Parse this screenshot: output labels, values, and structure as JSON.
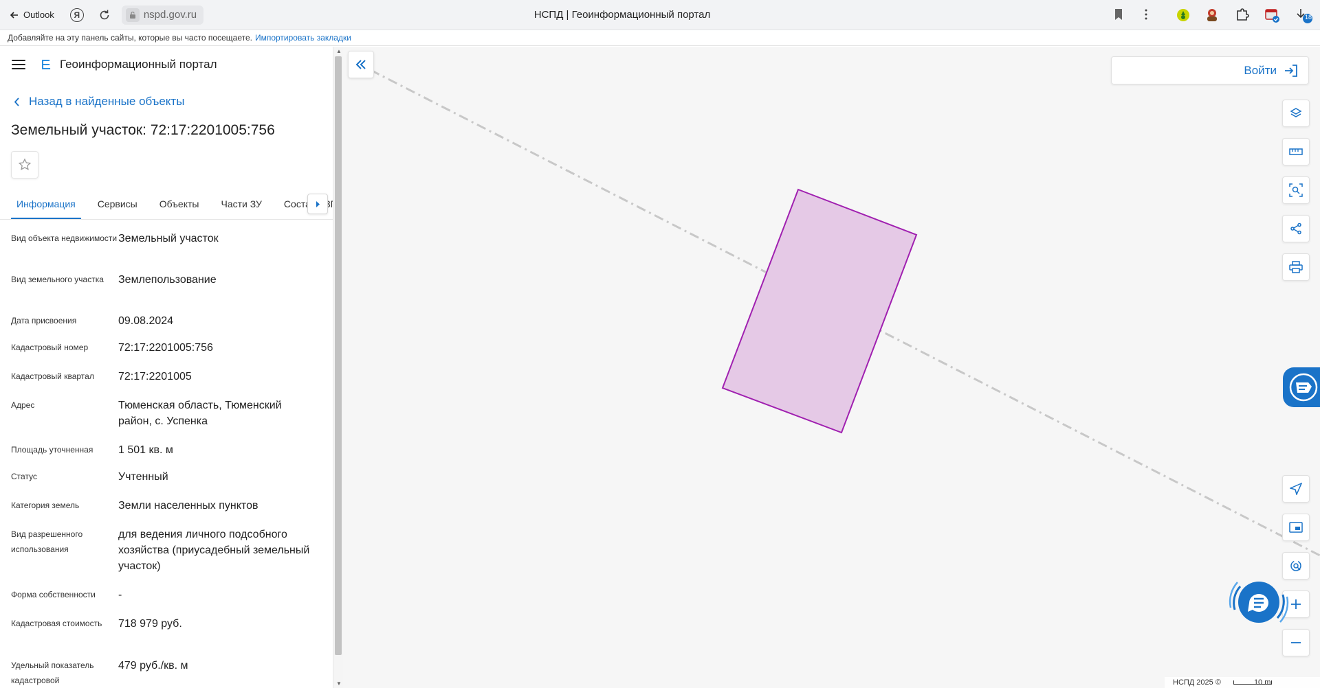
{
  "browser": {
    "back_label": "Outlook",
    "url": "nspd.gov.ru",
    "tab_title": "НСПД | Геоинформационный портал",
    "bookmarks_prompt": "Добавляйте на эту панель сайты, которые вы часто посещаете.",
    "bookmarks_import": "Импортировать закладки",
    "ya_label": "Я"
  },
  "portal": {
    "name": "Геоинформационный портал",
    "back_label": "Назад в найденные объекты",
    "title": "Земельный участок: 72:17:2201005:756"
  },
  "tabs": [
    {
      "label": "Информация",
      "active": true
    },
    {
      "label": "Сервисы",
      "active": false
    },
    {
      "label": "Объекты",
      "active": false
    },
    {
      "label": "Части ЗУ",
      "active": false
    },
    {
      "label": "Состав ЕЗП",
      "active": false
    }
  ],
  "properties": [
    {
      "label": "Вид объекта недвижимости",
      "value": "Земельный участок"
    },
    {
      "label": "Вид земельного участка",
      "value": "Землепользование"
    },
    {
      "label": "Дата присвоения",
      "value": "09.08.2024"
    },
    {
      "label": "Кадастровый номер",
      "value": "72:17:2201005:756"
    },
    {
      "label": "Кадастровый квартал",
      "value": "72:17:2201005"
    },
    {
      "label": "Адрес",
      "value": "Тюменская область, Тюменский район, с. Успенка"
    },
    {
      "label": "Площадь уточненная",
      "value": "1 501 кв. м"
    },
    {
      "label": "Статус",
      "value": "Учтенный"
    },
    {
      "label": "Категория земель",
      "value": "Земли населенных пунктов"
    },
    {
      "label": "Вид разрешенного использования",
      "value": "для ведения личного подсобного хозяйства (приусадебный земельный участок)"
    },
    {
      "label": "Форма собственности",
      "value": "-"
    },
    {
      "label": "Кадастровая стоимость",
      "value": "718 979 руб."
    },
    {
      "label": "Удельный показатель кадастровой",
      "value": "479 руб./кв. м"
    }
  ],
  "map": {
    "login_label": "Войти",
    "attribution": "НСПД 2025 ©",
    "scale_label": "10 m",
    "parcel_fill": "#e5c9e6",
    "parcel_stroke": "#a020b0",
    "accent": "#1a73c8"
  },
  "extensions": {
    "badge_count": "18"
  }
}
